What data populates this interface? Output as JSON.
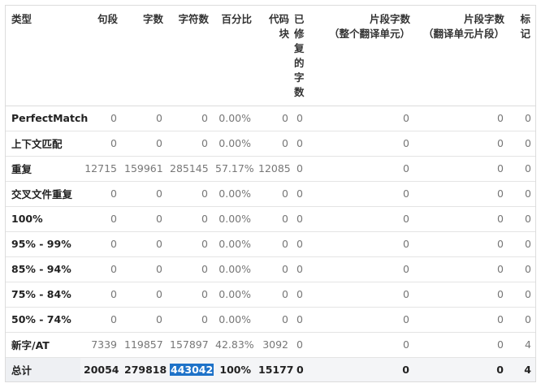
{
  "headers": {
    "type": "类型",
    "segments": "句段",
    "words": "字数",
    "chars": "字符数",
    "percent": "百分比",
    "code_blocks": "代码块",
    "fixed_words": "已修复的字数",
    "frag_words_unit": "片段字数\n（整个翻译单元）",
    "frag_words_seg": "片段字数\n（翻译单元片段）",
    "tags": "标记"
  },
  "rows": [
    {
      "type": "PerfectMatch",
      "segments": "0",
      "words": "0",
      "chars": "0",
      "percent": "0.00%",
      "code": "0",
      "fixed": "0",
      "frag_unit": "0",
      "frag_seg": "0",
      "tags": "0"
    },
    {
      "type": "上下文匹配",
      "segments": "0",
      "words": "0",
      "chars": "0",
      "percent": "0.00%",
      "code": "0",
      "fixed": "0",
      "frag_unit": "0",
      "frag_seg": "0",
      "tags": "0"
    },
    {
      "type": "重复",
      "segments": "12715",
      "words": "159961",
      "chars": "285145",
      "percent": "57.17%",
      "code": "12085",
      "fixed": "0",
      "frag_unit": "0",
      "frag_seg": "0",
      "tags": "0"
    },
    {
      "type": "交叉文件重复",
      "segments": "0",
      "words": "0",
      "chars": "0",
      "percent": "0.00%",
      "code": "0",
      "fixed": "0",
      "frag_unit": "0",
      "frag_seg": "0",
      "tags": "0"
    },
    {
      "type": "100%",
      "segments": "0",
      "words": "0",
      "chars": "0",
      "percent": "0.00%",
      "code": "0",
      "fixed": "0",
      "frag_unit": "0",
      "frag_seg": "0",
      "tags": "0"
    },
    {
      "type": "95% - 99%",
      "segments": "0",
      "words": "0",
      "chars": "0",
      "percent": "0.00%",
      "code": "0",
      "fixed": "0",
      "frag_unit": "0",
      "frag_seg": "0",
      "tags": "0"
    },
    {
      "type": "85% - 94%",
      "segments": "0",
      "words": "0",
      "chars": "0",
      "percent": "0.00%",
      "code": "0",
      "fixed": "0",
      "frag_unit": "0",
      "frag_seg": "0",
      "tags": "0"
    },
    {
      "type": "75% - 84%",
      "segments": "0",
      "words": "0",
      "chars": "0",
      "percent": "0.00%",
      "code": "0",
      "fixed": "0",
      "frag_unit": "0",
      "frag_seg": "0",
      "tags": "0"
    },
    {
      "type": "50% - 74%",
      "segments": "0",
      "words": "0",
      "chars": "0",
      "percent": "0.00%",
      "code": "0",
      "fixed": "0",
      "frag_unit": "0",
      "frag_seg": "0",
      "tags": "0"
    },
    {
      "type": "新字/AT",
      "segments": "7339",
      "words": "119857",
      "chars": "157897",
      "percent": "42.83%",
      "code": "3092",
      "fixed": "0",
      "frag_unit": "0",
      "frag_seg": "0",
      "tags": "4"
    }
  ],
  "total": {
    "type": "总计",
    "segments": "20054",
    "words": "279818",
    "chars": "443042",
    "percent": "100%",
    "code": "15177",
    "fixed": "0",
    "frag_unit": "0",
    "frag_seg": "0",
    "tags": "4"
  },
  "selected_cell": "total.chars",
  "colors": {
    "selection": "#1e72c8",
    "border": "#dcdcdc",
    "total_bg": "#f4f5f7"
  }
}
